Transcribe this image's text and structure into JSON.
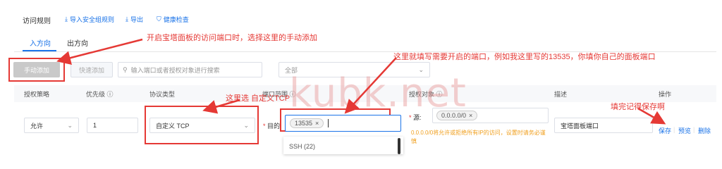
{
  "header": {
    "title": "访问规则",
    "import_group": "导入安全组规则",
    "export": "导出",
    "health_check": "健康检查"
  },
  "tabs": [
    {
      "label": "入方向"
    },
    {
      "label": "出方向"
    }
  ],
  "toolbar": {
    "manual_add": "手动添加",
    "quick_add": "快速添加",
    "search_placeholder": "输入端口或者授权对象进行搜索",
    "filter_placeholder": "全部"
  },
  "columns": {
    "policy": "授权策略",
    "priority": "优先级",
    "protocol": "协议类型",
    "port": "端口范围",
    "object": "授权对象",
    "desc": "描述",
    "action": "操作"
  },
  "row": {
    "policy": "允许",
    "priority": "1",
    "protocol": "自定义 TCP",
    "port_prefix": "目的:",
    "port_tag": "13535",
    "source_prefix": "源:",
    "source_tag": "0.0.0.0/0",
    "source_help": "0.0.0.0/0将允许或拒绝所有IP的访问，设置时请务必谨慎",
    "desc": "宝塔面板端口",
    "save": "保存",
    "preview": "预览",
    "delete": "删除"
  },
  "dropdown": {
    "option": "SSH (22)"
  },
  "annotations": {
    "manual": "开启宝塔面板的访问端口时，选择这里的手动添加",
    "port": "这里就填写需要开启的端口，例如我这里写的13535，你填你自己的面板端口",
    "tcp": "这里选 自定义TCP",
    "save": "填完记得保存啊"
  },
  "watermark": "kubk.net",
  "colors": {
    "accent": "#1a73e8",
    "annotation": "#e53935"
  }
}
